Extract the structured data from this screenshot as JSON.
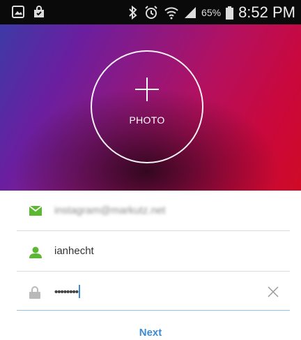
{
  "status_bar": {
    "battery_percent": "65%",
    "time": "8:52 PM",
    "icons": [
      "gallery-icon",
      "shopping-bag-icon",
      "bluetooth-icon",
      "alarm-icon",
      "wifi-icon",
      "signal-icon",
      "battery-icon"
    ]
  },
  "hero": {
    "photo_label": "PHOTO",
    "colors": {
      "start": "#3d3aa6",
      "middle": "#8f1880",
      "end": "#d00a26"
    }
  },
  "form": {
    "email": {
      "value": "instagram@markutz.net",
      "icon": "mail-icon",
      "icon_color": "#5cb833"
    },
    "username": {
      "value": "ianhecht",
      "icon": "person-icon",
      "icon_color": "#5cb833"
    },
    "password": {
      "value": "••••••••",
      "icon": "lock-icon",
      "icon_color": "#b9b9b9",
      "clear_icon": "close-icon"
    }
  },
  "actions": {
    "next_label": "Next",
    "accent": "#3d8bd1"
  }
}
